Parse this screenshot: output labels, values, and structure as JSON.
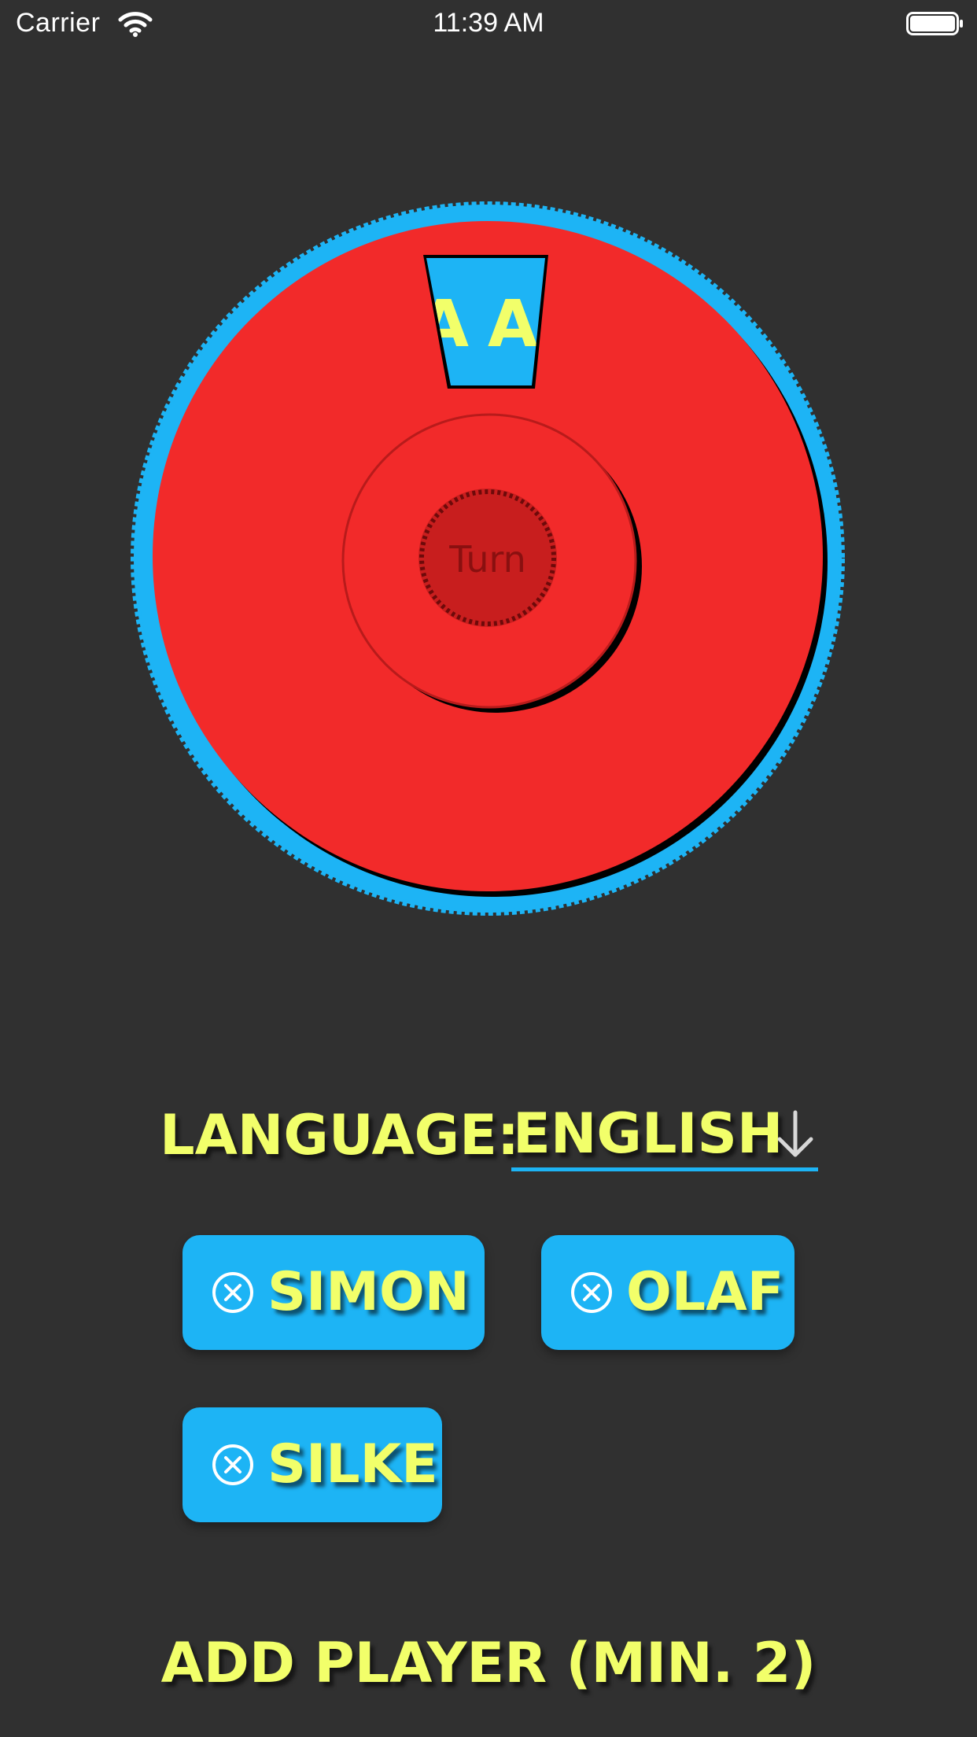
{
  "status_bar": {
    "carrier": "Carrier",
    "time": "11:39 AM",
    "wifi_icon": "wifi-icon",
    "battery_icon": "battery-icon"
  },
  "wheel": {
    "window_text": "AA",
    "turn_label": "Turn",
    "colors": {
      "face": "#f22a2a",
      "rim": "#1db4f5",
      "text": "#f2ff6a",
      "button": "#c81e1e"
    }
  },
  "language": {
    "label": "LANGUAGE:",
    "value": "ENGLISH",
    "icon": "arrow-down-icon"
  },
  "players": [
    {
      "name": "SIMON",
      "icon": "remove-circle-icon"
    },
    {
      "name": "OLAF",
      "icon": "remove-circle-icon"
    },
    {
      "name": "SILKE",
      "icon": "remove-circle-icon"
    }
  ],
  "add_player_label": "ADD PLAYER (MIN. 2)",
  "colors": {
    "background": "#303030",
    "accent_blue": "#1db4f5",
    "accent_yellow": "#f2ff6a"
  }
}
